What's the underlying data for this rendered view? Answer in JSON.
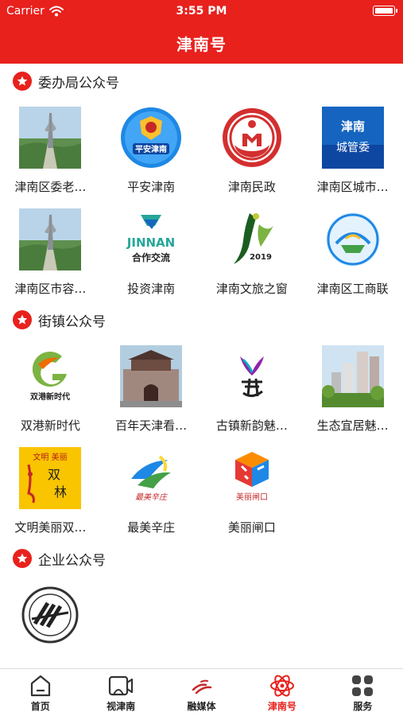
{
  "status_bar": {
    "carrier": "Carrier",
    "time": "3:55 PM"
  },
  "header": {
    "title": "津南号"
  },
  "sections": [
    {
      "title": "委办局公众号",
      "items": [
        {
          "label": "津南区委老…",
          "logo": "monument-photo"
        },
        {
          "label": "平安津南",
          "logo": "police-badge"
        },
        {
          "label": "津南民政",
          "logo": "civil-affairs-emblem"
        },
        {
          "label": "津南区城市…",
          "logo": "city-management-logo"
        },
        {
          "label": "津南区市容…",
          "logo": "monument-photo"
        },
        {
          "label": "投资津南",
          "logo": "jinnan-cooperation-logo"
        },
        {
          "label": "津南文旅之窗",
          "logo": "culture-tourism-2019-logo"
        },
        {
          "label": "津南区工商联",
          "logo": "federation-emblem"
        }
      ]
    },
    {
      "title": "街镇公众号",
      "items": [
        {
          "label": "双港新时代",
          "logo": "shuanggang-logo"
        },
        {
          "label": "百年天津看…",
          "logo": "city-gate-photo"
        },
        {
          "label": "古镇新韵魅…",
          "logo": "ancient-town-logo"
        },
        {
          "label": "生态宜居魅…",
          "logo": "apartments-photo"
        },
        {
          "label": "文明美丽双…",
          "logo": "shuanglin-yellow-logo"
        },
        {
          "label": "最美辛庄",
          "logo": "xinzhuang-logo"
        },
        {
          "label": "美丽闸口",
          "logo": "zhakou-cube-logo"
        }
      ]
    },
    {
      "title": "企业公众号",
      "items": [
        {
          "label": "",
          "logo": "enterprise-seal"
        }
      ]
    }
  ],
  "logo_text": {
    "city_management": [
      "津南",
      "城管委"
    ],
    "jinnan_brand": "JINNAN",
    "cooperation": "合作交流",
    "police": "平安津南",
    "year": "2019",
    "shuanggang": "双港新时代",
    "shuanglin": [
      "文明 美丽",
      "双",
      "林"
    ],
    "xinzhuang": "最美辛庄",
    "zhakou": "美丽闸口"
  },
  "tabs": [
    {
      "label": "首页",
      "icon": "home-icon"
    },
    {
      "label": "视津南",
      "icon": "video-icon"
    },
    {
      "label": "融媒体",
      "icon": "media-icon"
    },
    {
      "label": "津南号",
      "icon": "atom-icon",
      "active": true
    },
    {
      "label": "服务",
      "icon": "grid-icon"
    }
  ],
  "colors": {
    "brand": "#e8211d",
    "tab_inactive": "#333333"
  }
}
